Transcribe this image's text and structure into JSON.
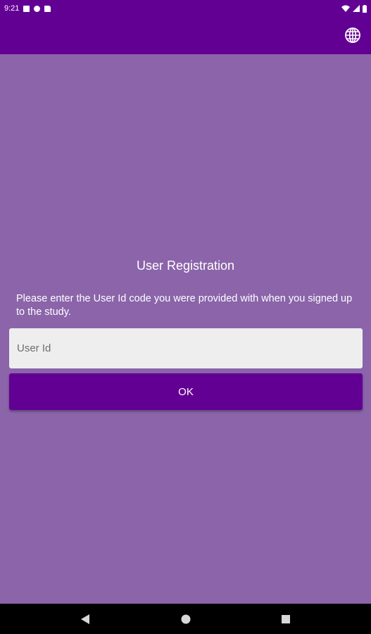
{
  "status_bar": {
    "time": "9:21",
    "icons": [
      "notification-icon",
      "photo-icon",
      "app-icon",
      "sd-card-icon"
    ],
    "right_icons": [
      "wifi-icon",
      "signal-icon",
      "battery-icon"
    ]
  },
  "app_bar": {
    "action_icon": "globe-icon",
    "color": "#630094"
  },
  "registration": {
    "title": "User Registration",
    "instructions": "Please enter the User Id code you were provided with when you signed up to the study.",
    "user_id": {
      "value": "",
      "placeholder": "User Id"
    },
    "ok_label": "OK"
  },
  "nav_bar": {
    "buttons": [
      "back-icon",
      "home-icon",
      "recents-icon"
    ]
  },
  "colors": {
    "primary": "#630094",
    "background": "#8b64aa",
    "field": "#eeeeee"
  }
}
